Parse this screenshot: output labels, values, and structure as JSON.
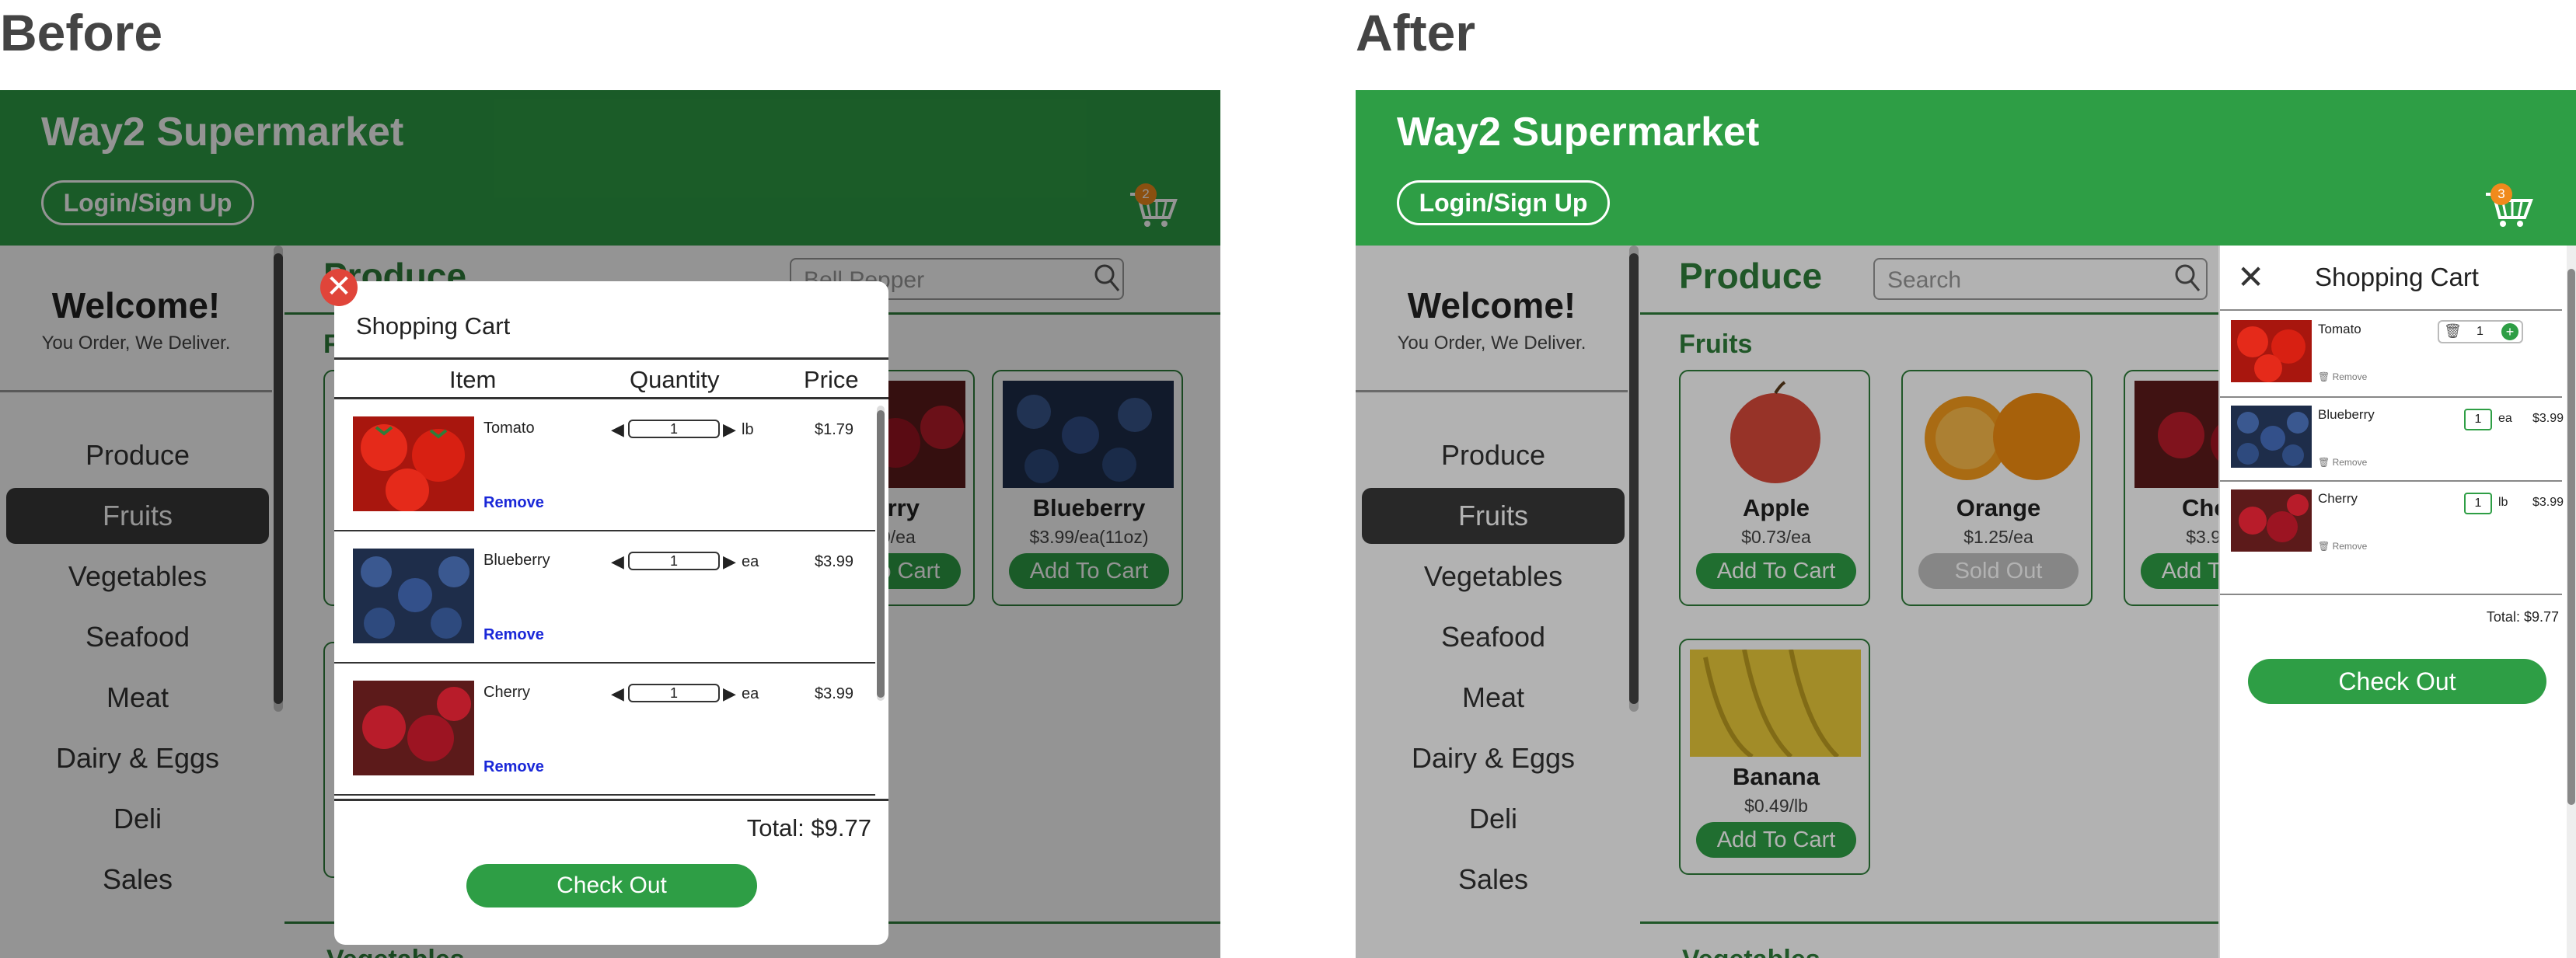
{
  "captions": {
    "before": "Before",
    "after": "After"
  },
  "app": {
    "title": "Way2 Supermarket",
    "login_label": "Login/Sign Up"
  },
  "before": {
    "cart_count": "2"
  },
  "after": {
    "cart_count": "3"
  },
  "sidebar": {
    "welcome": "Welcome!",
    "tagline": "You Order, We Deliver.",
    "items": [
      "Produce",
      "Fruits",
      "Vegetables",
      "Seafood",
      "Meat",
      "Dairy & Eggs",
      "Deli",
      "Sales"
    ],
    "selected": "Fruits"
  },
  "main": {
    "page_title": "Produce",
    "search_placeholder": "Search",
    "before_search_value": "Bell Pepper",
    "section_fruits": "Fruits",
    "section_vegetables": "Vegetables",
    "products": [
      {
        "name": "Apple",
        "price": "$0.73/ea",
        "button": "Add To Cart"
      },
      {
        "name": "Orange",
        "price": "$1.25/ea",
        "button": "Sold Out"
      },
      {
        "name": "Cherry",
        "price": "$3.99/ea",
        "button": "Add To Cart"
      },
      {
        "name": "Blueberry",
        "price": "$3.99/ea(11oz)",
        "button": "Add To Cart"
      },
      {
        "name": "Banana",
        "price": "$0.49/lb",
        "button": "Add To Cart"
      }
    ]
  },
  "modal": {
    "title": "Shopping Cart",
    "col_item": "Item",
    "col_quantity": "Quantity",
    "col_price": "Price",
    "remove_label": "Remove",
    "items": [
      {
        "name": "Tomato",
        "qty": "1",
        "unit": "lb",
        "price": "$1.79"
      },
      {
        "name": "Blueberry",
        "qty": "1",
        "unit": "ea",
        "price": "$3.99"
      },
      {
        "name": "Cherry",
        "qty": "1",
        "unit": "ea",
        "price": "$3.99"
      }
    ],
    "total": "Total: $9.77",
    "checkout": "Check Out"
  },
  "drawer": {
    "title": "Shopping Cart",
    "remove_label": "Remove",
    "items": [
      {
        "name": "Tomato",
        "qty": "1",
        "unit": "",
        "price": ""
      },
      {
        "name": "Blueberry",
        "qty": "1",
        "unit": "ea",
        "price": "$3.99"
      },
      {
        "name": "Cherry",
        "qty": "1",
        "unit": "lb",
        "price": "$3.99"
      }
    ],
    "total": "Total: $9.77",
    "checkout": "Check Out"
  },
  "colors": {
    "brand_green": "#2e9e45",
    "dark_green": "#2e7d3a",
    "badge_orange": "#f08a1c",
    "close_red": "#e0453a",
    "remove_blue": "#1a28d8"
  }
}
